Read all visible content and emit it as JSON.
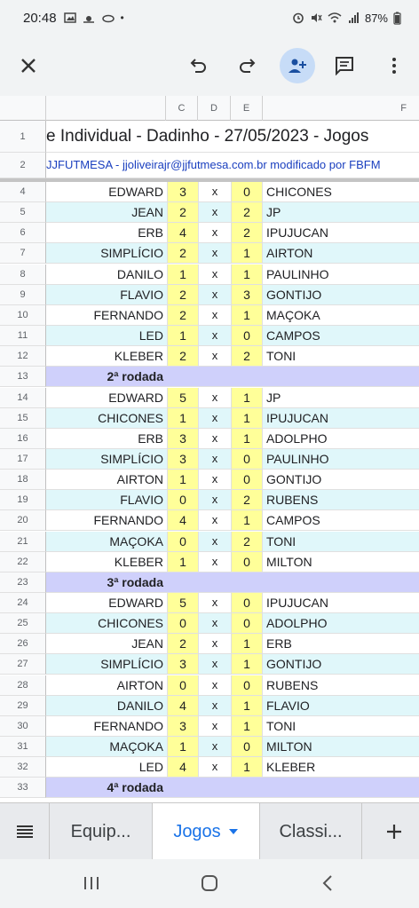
{
  "status": {
    "time": "20:48",
    "battery": "87%"
  },
  "toolbar": {
    "close": "close",
    "undo": "undo",
    "redo": "redo",
    "share": "add-person",
    "comment": "comment",
    "more": "more"
  },
  "columns": [
    "C",
    "D",
    "E",
    "F"
  ],
  "title": "e Individual - Dadinho - 27/05/2023 - Jogos",
  "subtitle": "JJFUTMESA - jjoliveirajr@jjfutmesa.com.br modificado por FBFM",
  "row_numbers": [
    "1",
    "2",
    "4",
    "5",
    "6",
    "7",
    "8",
    "9",
    "10",
    "11",
    "12",
    "13",
    "14",
    "15",
    "16",
    "17",
    "18",
    "19",
    "20",
    "21",
    "22",
    "23",
    "24",
    "25",
    "26",
    "27",
    "28",
    "29",
    "30",
    "31",
    "32",
    "33"
  ],
  "rows": [
    {
      "type": "match",
      "home": "EDWARD",
      "hs": "3",
      "sep": "x",
      "as": "0",
      "away": "CHICONES"
    },
    {
      "type": "match",
      "home": "JEAN",
      "hs": "2",
      "sep": "x",
      "as": "2",
      "away": "JP"
    },
    {
      "type": "match",
      "home": "ERB",
      "hs": "4",
      "sep": "x",
      "as": "2",
      "away": "IPUJUCAN"
    },
    {
      "type": "match",
      "home": "SIMPLÍCIO",
      "hs": "2",
      "sep": "x",
      "as": "1",
      "away": "AIRTON"
    },
    {
      "type": "match",
      "home": "DANILO",
      "hs": "1",
      "sep": "x",
      "as": "1",
      "away": "PAULINHO"
    },
    {
      "type": "match",
      "home": "FLAVIO",
      "hs": "2",
      "sep": "x",
      "as": "3",
      "away": "GONTIJO"
    },
    {
      "type": "match",
      "home": "FERNANDO",
      "hs": "2",
      "sep": "x",
      "as": "1",
      "away": "MAÇOKA"
    },
    {
      "type": "match",
      "home": "LED",
      "hs": "1",
      "sep": "x",
      "as": "0",
      "away": "CAMPOS"
    },
    {
      "type": "match",
      "home": "KLEBER",
      "hs": "2",
      "sep": "x",
      "as": "2",
      "away": "TONI"
    },
    {
      "type": "round",
      "label": "2ª rodada"
    },
    {
      "type": "match",
      "home": "EDWARD",
      "hs": "5",
      "sep": "x",
      "as": "1",
      "away": "JP"
    },
    {
      "type": "match",
      "home": "CHICONES",
      "hs": "1",
      "sep": "x",
      "as": "1",
      "away": "IPUJUCAN"
    },
    {
      "type": "match",
      "home": "ERB",
      "hs": "3",
      "sep": "x",
      "as": "1",
      "away": "ADOLPHO"
    },
    {
      "type": "match",
      "home": "SIMPLÍCIO",
      "hs": "3",
      "sep": "x",
      "as": "0",
      "away": "PAULINHO"
    },
    {
      "type": "match",
      "home": "AIRTON",
      "hs": "1",
      "sep": "x",
      "as": "0",
      "away": "GONTIJO"
    },
    {
      "type": "match",
      "home": "FLAVIO",
      "hs": "0",
      "sep": "x",
      "as": "2",
      "away": "RUBENS"
    },
    {
      "type": "match",
      "home": "FERNANDO",
      "hs": "4",
      "sep": "x",
      "as": "1",
      "away": "CAMPOS"
    },
    {
      "type": "match",
      "home": "MAÇOKA",
      "hs": "0",
      "sep": "x",
      "as": "2",
      "away": "TONI"
    },
    {
      "type": "match",
      "home": "KLEBER",
      "hs": "1",
      "sep": "x",
      "as": "0",
      "away": "MILTON"
    },
    {
      "type": "round",
      "label": "3ª rodada"
    },
    {
      "type": "match",
      "home": "EDWARD",
      "hs": "5",
      "sep": "x",
      "as": "0",
      "away": "IPUJUCAN"
    },
    {
      "type": "match",
      "home": "CHICONES",
      "hs": "0",
      "sep": "x",
      "as": "0",
      "away": "ADOLPHO"
    },
    {
      "type": "match",
      "home": "JEAN",
      "hs": "2",
      "sep": "x",
      "as": "1",
      "away": "ERB"
    },
    {
      "type": "match",
      "home": "SIMPLÍCIO",
      "hs": "3",
      "sep": "x",
      "as": "1",
      "away": "GONTIJO"
    },
    {
      "type": "match",
      "home": "AIRTON",
      "hs": "0",
      "sep": "x",
      "as": "0",
      "away": "RUBENS"
    },
    {
      "type": "match",
      "home": "DANILO",
      "hs": "4",
      "sep": "x",
      "as": "1",
      "away": "FLAVIO"
    },
    {
      "type": "match",
      "home": "FERNANDO",
      "hs": "3",
      "sep": "x",
      "as": "1",
      "away": "TONI"
    },
    {
      "type": "match",
      "home": "MAÇOKA",
      "hs": "1",
      "sep": "x",
      "as": "0",
      "away": "MILTON"
    },
    {
      "type": "match",
      "home": "LED",
      "hs": "4",
      "sep": "x",
      "as": "1",
      "away": "KLEBER"
    },
    {
      "type": "round",
      "label": "4ª rodada"
    }
  ],
  "tabs": [
    {
      "label": "Equip..."
    },
    {
      "label": "Jogos"
    },
    {
      "label": "Classi..."
    }
  ],
  "colors": {
    "score_bg": "#ffff99",
    "shade_bg": "#e0f7fa",
    "round_bg": "#cfd0fb",
    "accent": "#1a73e8"
  }
}
